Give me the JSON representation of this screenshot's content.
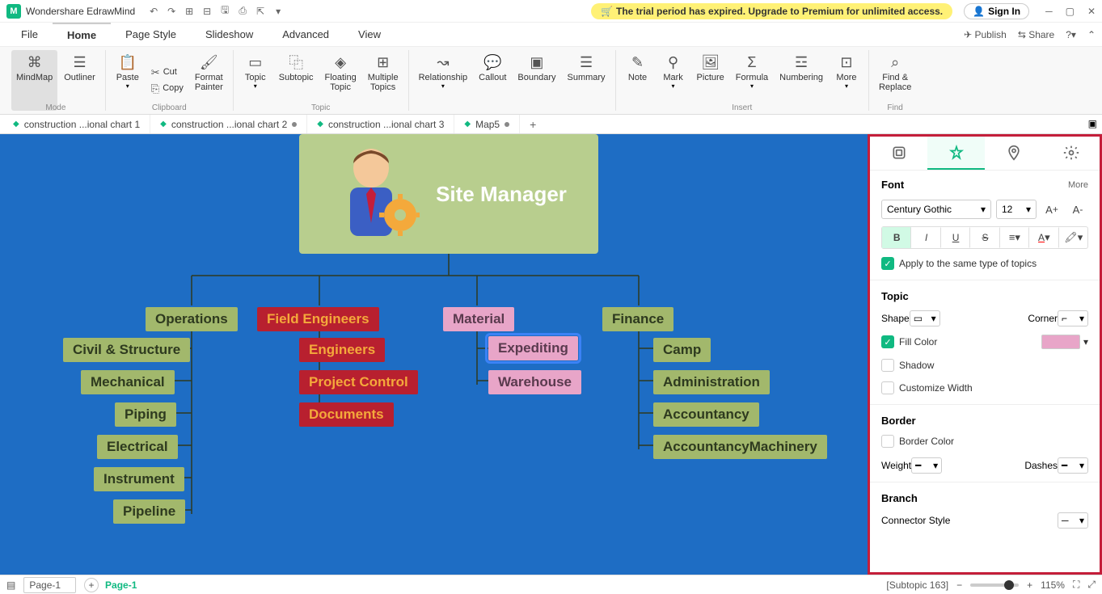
{
  "app": {
    "title": "Wondershare EdrawMind"
  },
  "trial": {
    "message": "The trial period has expired. Upgrade to Premium for unlimited access."
  },
  "signin": {
    "label": "Sign In"
  },
  "menu": {
    "file": "File",
    "home": "Home",
    "pagestyle": "Page Style",
    "slideshow": "Slideshow",
    "advanced": "Advanced",
    "view": "View",
    "publish": "Publish",
    "share": "Share"
  },
  "ribbon": {
    "mindmap": "MindMap",
    "outliner": "Outliner",
    "paste": "Paste",
    "cut": "Cut",
    "copy": "Copy",
    "fmtpainter": "Format\nPainter",
    "topic": "Topic",
    "subtopic": "Subtopic",
    "floating": "Floating\nTopic",
    "multiple": "Multiple\nTopics",
    "relationship": "Relationship",
    "callout": "Callout",
    "boundary": "Boundary",
    "summary": "Summary",
    "note": "Note",
    "mark": "Mark",
    "picture": "Picture",
    "formula": "Formula",
    "numbering": "Numbering",
    "more": "More",
    "findreplace": "Find &\nReplace",
    "grp_mode": "Mode",
    "grp_clipboard": "Clipboard",
    "grp_topic": "Topic",
    "grp_insert": "Insert",
    "grp_find": "Find"
  },
  "tabs": {
    "t1": "construction ...ional chart 1",
    "t2": "construction ...ional chart 2",
    "t3": "construction ...ional chart 3",
    "t4": "Map5"
  },
  "chart_data": {
    "type": "tree",
    "root": "Site Manager",
    "children": [
      {
        "name": "Operations",
        "color": "olive",
        "children": [
          "Civil & Structure",
          "Mechanical",
          "Piping",
          "Electrical",
          "Instrument",
          "Pipeline"
        ]
      },
      {
        "name": "Field Engineers",
        "color": "red",
        "children": [
          "Engineers",
          "Project Control",
          "Documents"
        ]
      },
      {
        "name": "Material",
        "color": "pink",
        "children": [
          "Expediting",
          "Warehouse"
        ]
      },
      {
        "name": "Finance",
        "color": "olive",
        "children": [
          "Camp",
          "Administration",
          "Accountancy",
          "AccountancyMachinery"
        ]
      }
    ],
    "selected": "Expediting"
  },
  "panel": {
    "font_head": "Font",
    "more": "More",
    "font_family": "Century Gothic",
    "font_size": "12",
    "apply_same": "Apply to the same type of topics",
    "topic_head": "Topic",
    "shape": "Shape",
    "corner": "Corner",
    "fillcolor": "Fill Color",
    "shadow": "Shadow",
    "custwidth": "Customize Width",
    "border_head": "Border",
    "bordercolor": "Border Color",
    "weight": "Weight",
    "dashes": "Dashes",
    "branch_head": "Branch",
    "connstyle": "Connector Style",
    "fill_swatch": "#e8a5c8"
  },
  "status": {
    "pagedd": "Page-1",
    "pagetab": "Page-1",
    "info": "[Subtopic 163]",
    "zoom": "115%"
  }
}
